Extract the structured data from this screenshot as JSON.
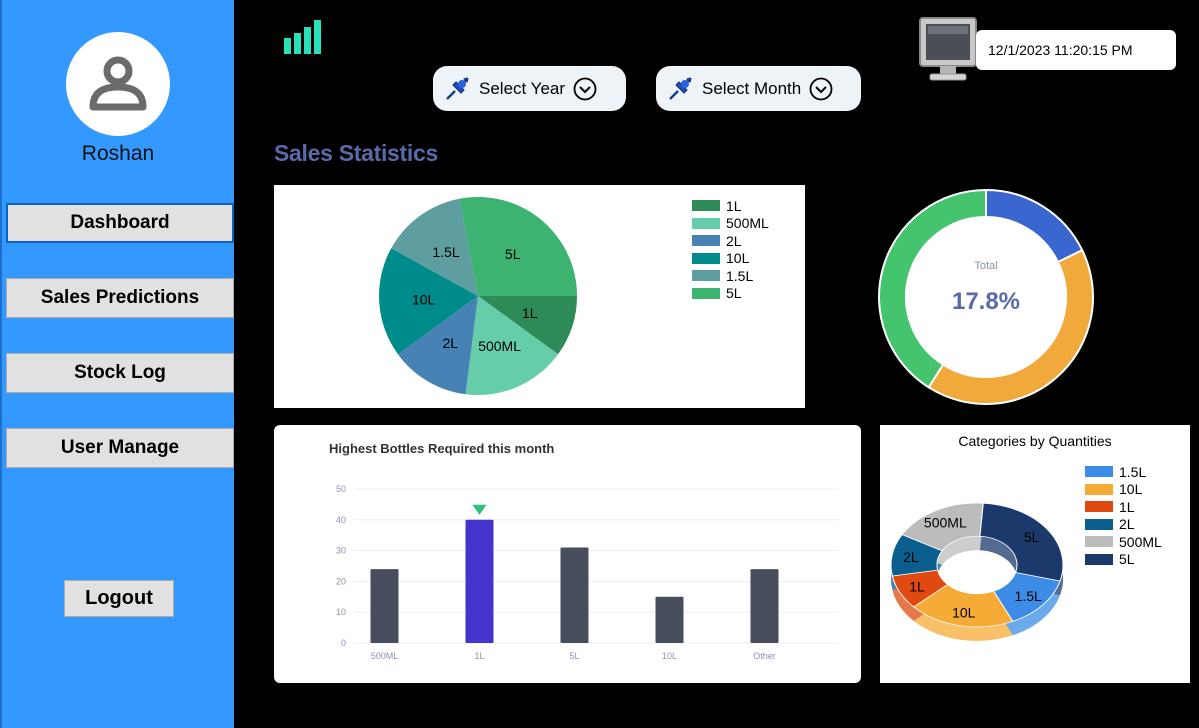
{
  "user": {
    "name": "Roshan"
  },
  "nav": {
    "items": [
      {
        "label": "Dashboard",
        "active": true
      },
      {
        "label": "Sales Predictions",
        "active": false
      },
      {
        "label": "Stock Log",
        "active": false
      },
      {
        "label": "User Manage",
        "active": false
      }
    ],
    "logout_label": "Logout"
  },
  "filters": {
    "year_label": "Select Year",
    "month_label": "Select Month"
  },
  "datetime": "12/1/2023 11:20:15 PM",
  "section_title": "Sales Statistics",
  "colors": {
    "sidebar": "#3399ff",
    "accent_title": "#5a6aa8"
  },
  "chart_data": [
    {
      "type": "pie",
      "title": "",
      "labels": [
        "1L",
        "500ML",
        "2L",
        "10L",
        "1.5L",
        "5L"
      ],
      "values": [
        10,
        17,
        13,
        18,
        14,
        28
      ],
      "colors": [
        "#2e8b57",
        "#66cdaa",
        "#4682b4",
        "#008b8b",
        "#5f9ea0",
        "#3cb371"
      ],
      "legend": "top-right"
    },
    {
      "type": "pie",
      "title": "",
      "center_label": "Total",
      "center_value": "17.8%",
      "values": [
        17.8,
        41.2,
        41.0
      ],
      "colors": [
        "#3a66d0",
        "#f2a93b",
        "#45c46e"
      ]
    },
    {
      "type": "bar",
      "title": "Highest Bottles Required this month",
      "categories": [
        "500ML",
        "1L",
        "5L",
        "10L",
        "Other"
      ],
      "values": [
        24,
        40,
        31,
        15,
        24
      ],
      "ylim": [
        0,
        50
      ],
      "yticks": [
        "0",
        "10",
        "20",
        "30",
        "40",
        "50"
      ],
      "highlight_index": 1,
      "bar_color": "#474d5c",
      "highlight_color": "#4433cc"
    },
    {
      "type": "pie",
      "title": "Categories by Quantities",
      "labels": [
        "1.5L",
        "10L",
        "1L",
        "2L",
        "500ML",
        "5L"
      ],
      "values": [
        14,
        20,
        9,
        11,
        18,
        28
      ],
      "colors": [
        "#3c8ce7",
        "#f5ab35",
        "#e04a10",
        "#0b5f8f",
        "#bcbcbc",
        "#1b3a6b"
      ],
      "legend": "top-right"
    }
  ]
}
